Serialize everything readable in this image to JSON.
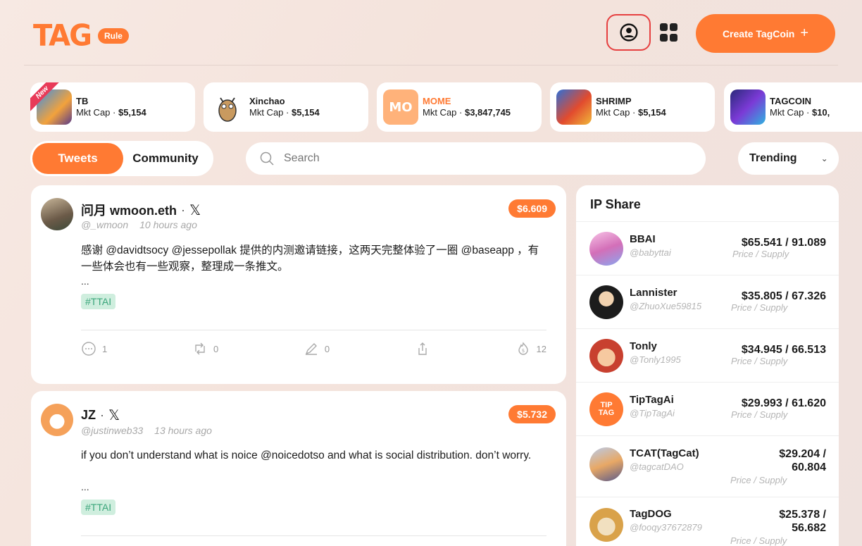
{
  "header": {
    "logo_text": "TAG",
    "logo_badge": "Rule",
    "create_label": "Create TagCoin",
    "create_plus": "+",
    "profile_icon": "user-circle-icon",
    "apps_icon": "grid-icon"
  },
  "coins": [
    {
      "name": "TB",
      "cap_label": "Mkt Cap · ",
      "cap_value": "$5,154",
      "badge": "New"
    },
    {
      "name": "Xinchao",
      "cap_label": "Mkt Cap · ",
      "cap_value": "$5,154"
    },
    {
      "name": "MOME",
      "cap_label": "Mkt Cap · ",
      "cap_value": "$3,847,745",
      "avatar_text": "MO"
    },
    {
      "name": "SHRIMP",
      "cap_label": "Mkt Cap · ",
      "cap_value": "$5,154"
    },
    {
      "name": "TAGCOIN",
      "cap_label": "Mkt Cap · ",
      "cap_value": "$10,"
    }
  ],
  "tabs": [
    {
      "label": "Tweets",
      "active": true
    },
    {
      "label": "Community",
      "active": false
    }
  ],
  "search": {
    "placeholder": "Search"
  },
  "sort": {
    "label": "Trending",
    "icon": "chevron-down-icon"
  },
  "tweets": [
    {
      "name": "问月 wmoon.eth",
      "separator": "·",
      "x_icon": "𝕏",
      "handle": "@_wmoon",
      "time": "10 hours ago",
      "price": "$6.609",
      "body": "感谢 @davidtsocy @jessepollak 提供的内测邀请链接，这两天完整体验了一圈 @baseapp ，有一些体会也有一些观察，整理成一条推文。",
      "ellipsis": "...",
      "tag": "#TTAI",
      "comments": "1",
      "retweets": "0",
      "edits": "0",
      "fire": "12"
    },
    {
      "name": "JZ",
      "separator": "·",
      "x_icon": "𝕏",
      "handle": "@justinweb33",
      "time": "13 hours ago",
      "price": "$5.732",
      "body": "if you don’t understand what is noice @noicedotso and what is social distribution. don’t worry.",
      "ellipsis": "...",
      "tag": "#TTAI"
    }
  ],
  "ip_share": {
    "title": "IP Share",
    "price_label": "Price / Supply",
    "items": [
      {
        "name": "BBAI",
        "handle": "@babyttai",
        "price": "$65.541 / 91.089"
      },
      {
        "name": "Lannister",
        "handle": "@ZhuoXue59815",
        "price": "$35.805 / 67.326"
      },
      {
        "name": "Tonly",
        "handle": "@Tonly1995",
        "price": "$34.945 / 66.513"
      },
      {
        "name": "TipTagAi",
        "handle": "@TipTagAi",
        "price": "$29.993 / 61.620",
        "avatar_text": "TIP TAG"
      },
      {
        "name": "TCAT(TagCat)",
        "handle": "@tagcatDAO",
        "price_line1": "$29.204 /",
        "price_line2": "60.804"
      },
      {
        "name": "TagDOG",
        "handle": "@fooqy37672879",
        "price_line1": "$25.378 /",
        "price_line2": "56.682"
      }
    ]
  },
  "colors": {
    "accent": "#ff7a33",
    "tag_bg": "#cfeede",
    "tag_text": "#3aa57a",
    "highlight_border": "#e64040"
  }
}
